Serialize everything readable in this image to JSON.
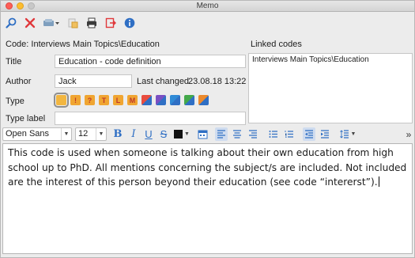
{
  "window": {
    "title": "Memo"
  },
  "toolbar": {
    "buttons": [
      {
        "name": "search-icon"
      },
      {
        "name": "delete-icon"
      },
      {
        "name": "code-dropdown-icon"
      },
      {
        "name": "print-icon"
      },
      {
        "name": "export-icon"
      },
      {
        "name": "info-icon"
      }
    ]
  },
  "form": {
    "code_label": "Code: Interviews Main Topics\\Education",
    "linked_codes_label": "Linked codes",
    "linked_codes": [
      "Interviews Main Topics\\Education"
    ],
    "title_label": "Title",
    "title_value": "Education - code definition",
    "author_label": "Author",
    "author_value": "Jack",
    "last_changed_label": "Last changed",
    "last_changed_value": "23.08.18 13:22",
    "type_label": "Type",
    "type_label_label": "Type label",
    "type_label_value": "",
    "memo_types": [
      {
        "name": "memo-type-yellow",
        "symbol": "",
        "color": "#f2b640",
        "selected": true
      },
      {
        "name": "memo-type-exclamation",
        "symbol": "!",
        "color": "#f0a531"
      },
      {
        "name": "memo-type-question",
        "symbol": "?",
        "color": "#f0a531"
      },
      {
        "name": "memo-type-t",
        "symbol": "T",
        "color": "#f0a531"
      },
      {
        "name": "memo-type-l",
        "symbol": "L",
        "color": "#f0a531"
      },
      {
        "name": "memo-type-m",
        "symbol": "M",
        "color": "#f0a531"
      },
      {
        "name": "memo-type-red-blue",
        "symbol": "",
        "color": "#e94d3f"
      },
      {
        "name": "memo-type-purple-blue",
        "symbol": "",
        "color": "#7a4fc2"
      },
      {
        "name": "memo-type-blue-green",
        "symbol": "",
        "color": "#2f8ad6"
      },
      {
        "name": "memo-type-green-blue",
        "symbol": "",
        "color": "#43a84a"
      },
      {
        "name": "memo-type-orange-blue",
        "symbol": "",
        "color": "#ec8a2c"
      }
    ]
  },
  "format_bar": {
    "font": "Open Sans",
    "size": "12",
    "bold": "B",
    "italic": "I",
    "underline": "U",
    "strike": "S",
    "more": "»"
  },
  "editor": {
    "text": "This code is used when someone is talking about their own education from high school up to PhD. All mentions concerning the subject/s are included. Not included are the interest of this person beyond their education (see code “intererst”)."
  },
  "colors": {
    "accent_blue": "#2f6fc4",
    "memo_orange": "#f0a531"
  }
}
